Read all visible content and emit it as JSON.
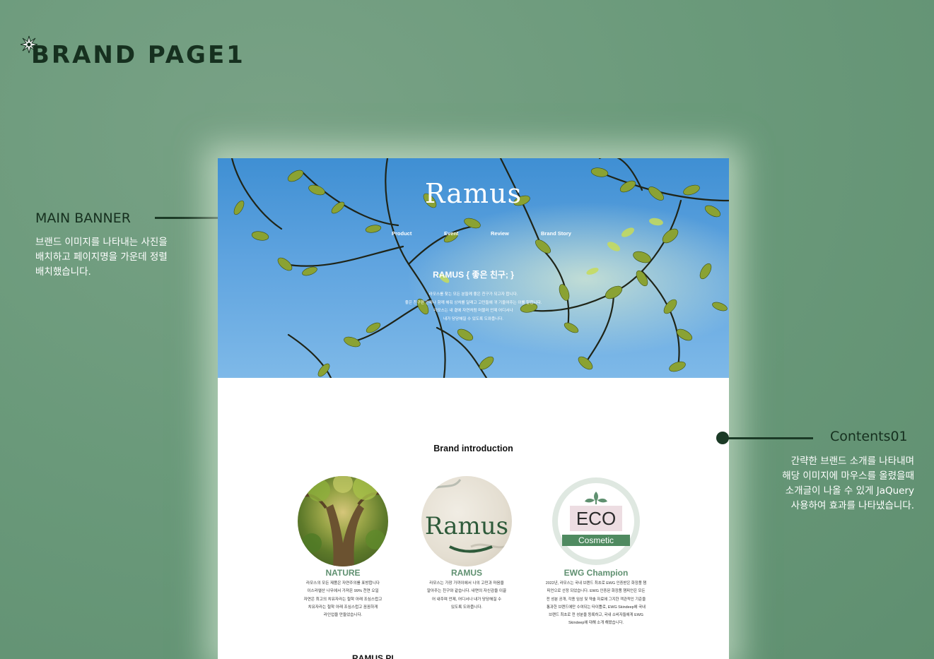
{
  "header": {
    "title": "BRAND PAGE1",
    "icon": "burst-icon"
  },
  "annotations": {
    "main_banner": {
      "title": "MAIN BANNER",
      "lines": [
        "브랜드 이미지를 나타내는 사진을",
        "배치하고 페이지명을 가운데 정렬",
        "배치했습니다."
      ]
    },
    "contents01": {
      "title": "Contents01",
      "lines": [
        "간략한 브랜드 소개를 나타내며",
        "해당 이미지에 마우스를 올렸을때",
        "소개글이 나올 수 있게 JaQuery",
        "사용하여 효과를 나타냈습니다."
      ]
    }
  },
  "site": {
    "logo": "Ramus",
    "nav": [
      "Product",
      "Event",
      "Review",
      "Brand Story"
    ],
    "hero": {
      "heading": "RAMUS { 좋은 친구; }",
      "lines": [
        "라모스를 찾는 모든 분들께 좋은 친구가 되고자 합니다.",
        "좋은 친구란 언제나 함께 해줘 상처를 달래고 고민들에 귀 기울여주는 이를 말합니다.",
        "라모스는 내 곁에 자연처럼 머물러 언제 어디서나",
        "내가 당당해질 수 있도록 도와줍니다."
      ]
    },
    "intro": {
      "title": "Brand introduction",
      "cards": [
        {
          "name": "NATURE",
          "lines": [
            "라모스의 모든 제품은 자연주의를 표방합니다",
            "이스라엘산 나무에서 가져온 99% 천연 오일",
            "자연은 최고의 치유자라는 철학 아래 조심스럽고",
            "치유자라는 철학 아래 조심스럽고 꼼꼼하게",
            "라인업을 만들었습니다."
          ]
        },
        {
          "name": "RAMUS",
          "lines": [
            "라모스는 가장 가까이에서 나의 고민과 마음을",
            "알아주는 친구와 같습니다. 내면의 자신감을 이끌",
            "어 내주며 언제, 어디서나 내가 당당해질 수",
            "있도록 도와줍니다."
          ]
        },
        {
          "name": "EWG Champion",
          "badge_top": "ECO",
          "badge_bottom": "Cosmetic",
          "lines": [
            "2022년, 라모스는 국내 브랜드 최초로 EWG 인증받은 화장품 챔",
            "피언으로 선정 되었습니다. EWG 인증된 화장품 챔피언은 모든",
            "전 성분 공개, 각종 임상 및 약솔 자료에 그지한 객관적인 기준을",
            "통과한 브랜드에만 수여되는 타이틀로, EWG Skindeep에 국내",
            "브랜드 최초로 전 성분을 등록하고, 국내 소비자들에게 EWG",
            "Skindeep에 대해 소개 해왔습니다."
          ]
        }
      ]
    },
    "next_section_title": "RAMUS PL"
  },
  "colors": {
    "background": "#6b9a7b",
    "dark_green": "#1b3a26",
    "accent_green": "#5f9070",
    "sky": "#4a97d9"
  }
}
